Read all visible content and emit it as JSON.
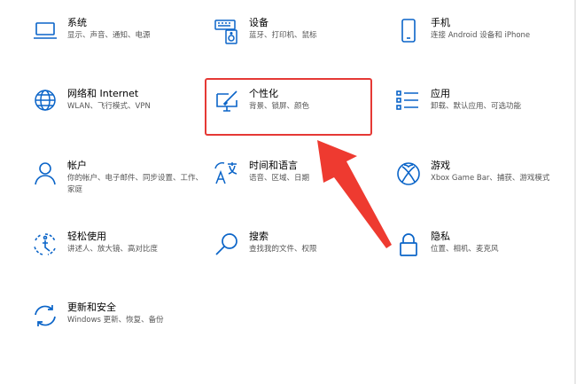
{
  "colors": {
    "icon": "#0a64c8",
    "arrow": "#ee3a30",
    "subtitle": "#555555"
  },
  "tiles": [
    {
      "icon": "laptop-icon",
      "title": "系统",
      "subtitle": "显示、声音、通知、电源"
    },
    {
      "icon": "keyboard-speaker-icon",
      "title": "设备",
      "subtitle": "蓝牙、打印机、鼠标"
    },
    {
      "icon": "phone-icon",
      "title": "手机",
      "subtitle": "连接 Android 设备和 iPhone"
    },
    {
      "icon": "globe-icon",
      "title": "网络和 Internet",
      "subtitle": "WLAN、飞行模式、VPN"
    },
    {
      "icon": "paint-monitor-icon",
      "title": "个性化",
      "subtitle": "背景、锁屏、颜色"
    },
    {
      "icon": "app-list-icon",
      "title": "应用",
      "subtitle": "卸载、默认应用、可选功能"
    },
    {
      "icon": "person-icon",
      "title": "帐户",
      "subtitle": "你的帐户、电子邮件、同步设置、工作、家庭"
    },
    {
      "icon": "time-language-icon",
      "title": "时间和语言",
      "subtitle": "语音、区域、日期"
    },
    {
      "icon": "xbox-icon",
      "title": "游戏",
      "subtitle": "Xbox Game Bar、捕获、游戏模式"
    },
    {
      "icon": "accessibility-icon",
      "title": "轻松使用",
      "subtitle": "讲述人、放大镜、高对比度"
    },
    {
      "icon": "search-icon",
      "title": "搜索",
      "subtitle": "查找我的文件、权限"
    },
    {
      "icon": "lock-icon",
      "title": "隐私",
      "subtitle": "位置、相机、麦克风"
    },
    {
      "icon": "update-icon",
      "title": "更新和安全",
      "subtitle": "Windows 更新、恢复、备份"
    }
  ]
}
